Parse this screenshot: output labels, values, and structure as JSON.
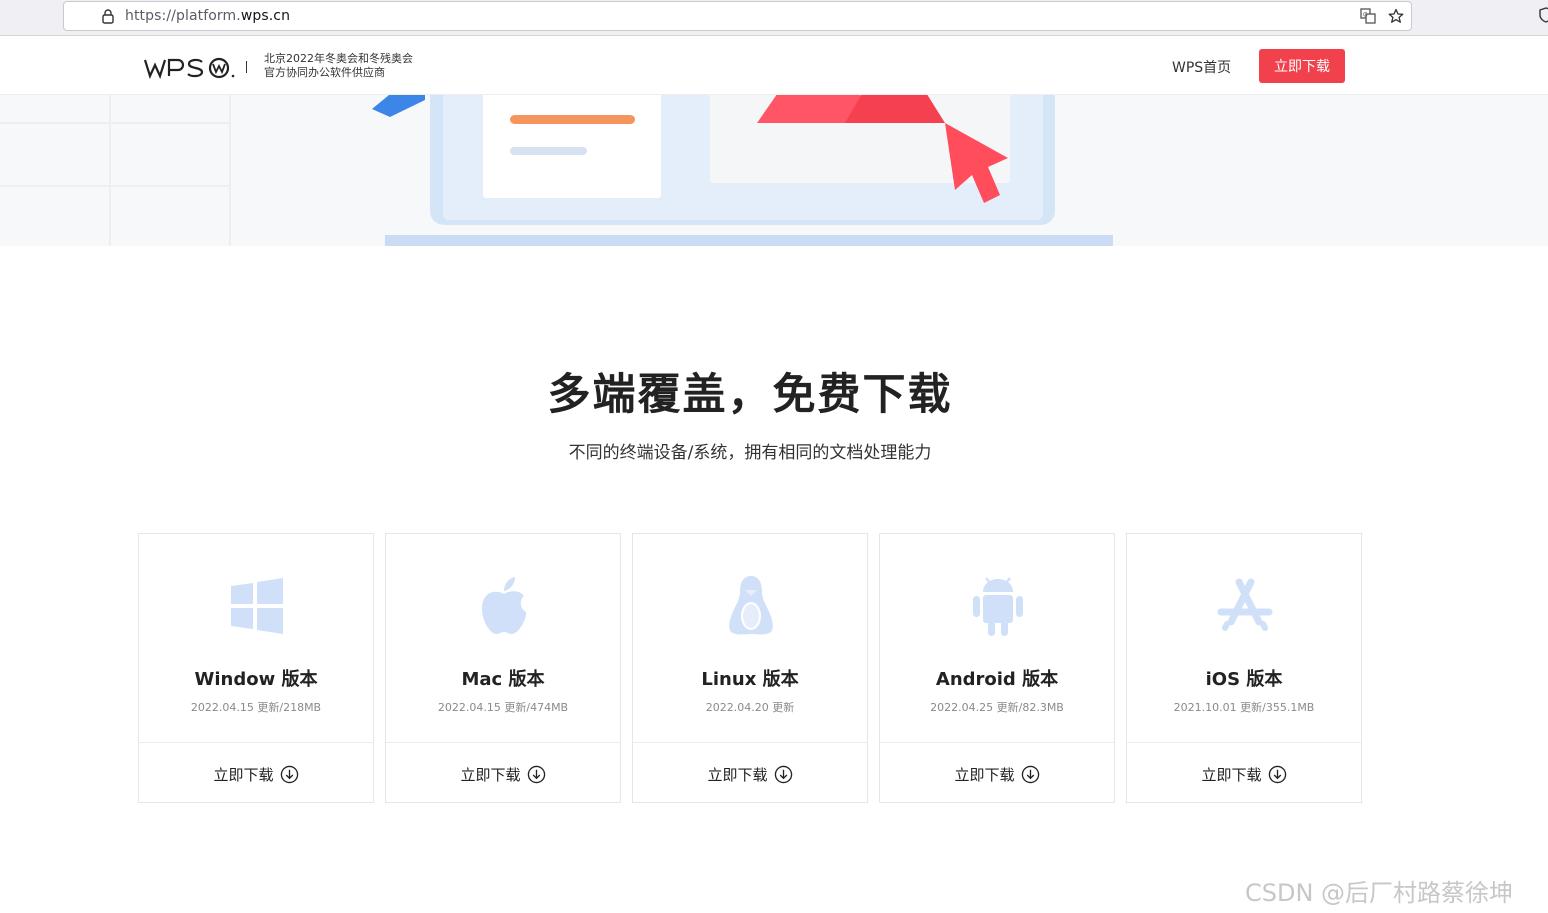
{
  "browser": {
    "url_prefix": "https://platform.",
    "url_host": "wps.cn"
  },
  "nav": {
    "logo_text": "WPS",
    "olympic_line1": "北京2022年冬奥会和冬残奥会",
    "olympic_line2": "官方协同办公软件供应商",
    "home_label": "WPS首页",
    "download_label": "立即下载"
  },
  "section": {
    "title": "多端覆盖，免费下载",
    "subtitle": "不同的终端设备/系统，拥有相同的文档处理能力"
  },
  "cards": [
    {
      "name": "Window 版本",
      "meta": "2022.04.15 更新/218MB",
      "download": "立即下载",
      "icon": "windows-icon"
    },
    {
      "name": "Mac 版本",
      "meta": "2022.04.15 更新/474MB",
      "download": "立即下载",
      "icon": "apple-icon"
    },
    {
      "name": "Linux 版本",
      "meta": "2022.04.20 更新",
      "download": "立即下载",
      "icon": "linux-penguin-icon"
    },
    {
      "name": "Android 版本",
      "meta": "2022.04.25 更新/82.3MB",
      "download": "立即下载",
      "icon": "android-icon"
    },
    {
      "name": "iOS 版本",
      "meta": "2021.10.01 更新/355.1MB",
      "download": "立即下载",
      "icon": "app-store-icon"
    }
  ],
  "watermark": "CSDN @后厂村路蔡徐坤",
  "colors": {
    "brand_red": "#f0414d",
    "icon_blue": "#cfe0f8",
    "hero_bg": "#f7f8fa"
  }
}
